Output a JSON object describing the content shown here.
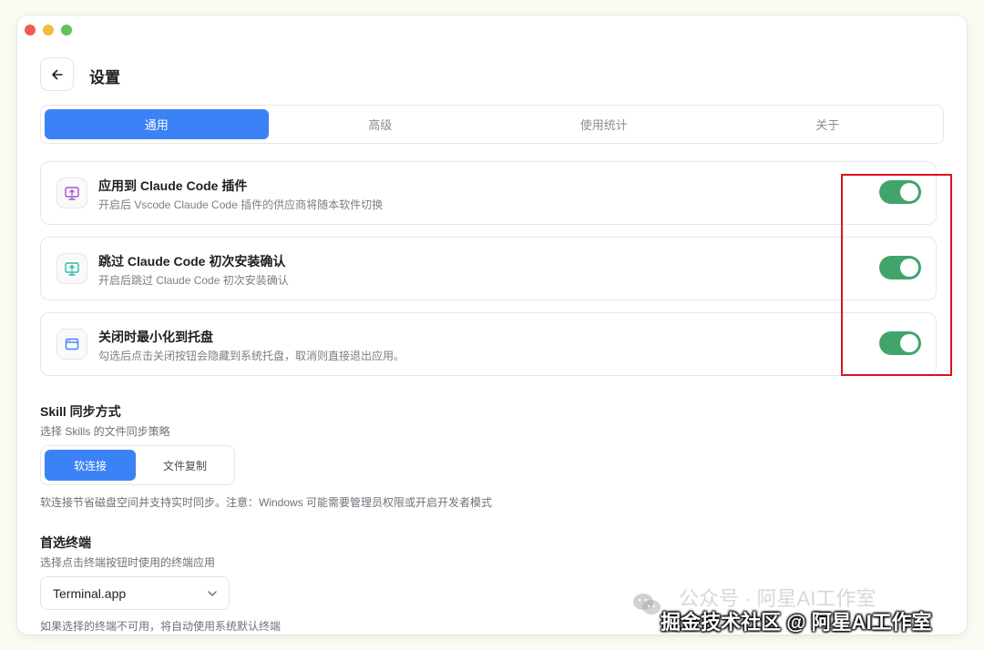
{
  "header": {
    "title": "设置"
  },
  "tabs": [
    {
      "label": "通用",
      "active": true
    },
    {
      "label": "高级",
      "active": false
    },
    {
      "label": "使用统计",
      "active": false
    },
    {
      "label": "关于",
      "active": false
    }
  ],
  "settings": [
    {
      "icon": "monitor-upload-icon",
      "title": "应用到 Claude Code 插件",
      "desc": "开启后 Vscode Claude Code 插件的供应商将随本软件切换",
      "enabled": true
    },
    {
      "icon": "monitor-upload-icon",
      "title": "跳过 Claude Code 初次安装确认",
      "desc": "开启后跳过 Claude Code 初次安装确认",
      "enabled": true
    },
    {
      "icon": "window-icon",
      "title": "关闭时最小化到托盘",
      "desc": "勾选后点击关闭按钮会隐藏到系统托盘，取消则直接退出应用。",
      "enabled": true
    }
  ],
  "skill_sync": {
    "title": "Skill 同步方式",
    "desc": "选择 Skills 的文件同步策略",
    "options": [
      "软连接",
      "文件复制"
    ],
    "selected": "软连接",
    "note": "软连接节省磁盘空间并支持实时同步。注意：Windows 可能需要管理员权限或开启开发者模式"
  },
  "terminal": {
    "title": "首选终端",
    "desc": "选择点击终端按钮时使用的终端应用",
    "value": "Terminal.app",
    "note": "如果选择的终端不可用，将自动使用系统默认终端"
  },
  "watermark": {
    "faint": "公众号 · 阿星AI工作室",
    "main": "掘金技术社区 @ 阿星AI工作室"
  },
  "colors": {
    "accent": "#3b82f6",
    "toggle_on": "#41a56b",
    "highlight": "#e0121e"
  }
}
